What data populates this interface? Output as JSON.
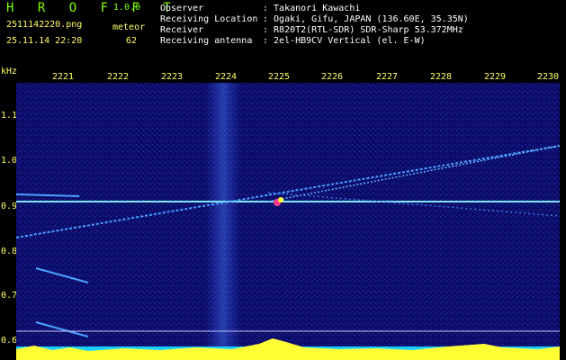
{
  "app": {
    "title": "H R O F F T",
    "version": "1.0.0"
  },
  "file": {
    "name": "2511142220.png",
    "datetime": "25.11.14 22:20"
  },
  "meteor": {
    "label": "meteor",
    "count": "62"
  },
  "station": {
    "observer": {
      "label": "Observer",
      "value": ": Takanori Kawachi"
    },
    "location": {
      "label": "Receiving Location",
      "value": ": Ogaki, Gifu, JAPAN (136.60E, 35.35N)"
    },
    "receiver": {
      "label": "Receiver",
      "value": ": R820T2(RTL-SDR) SDR-Sharp 53.372MHz"
    },
    "antenna": {
      "label": "Receiving antenna",
      "value": ": 2el-HB9CV Vertical (el. E-W)"
    }
  },
  "axes": {
    "y_unit": "kHz",
    "x_ticks": [
      "2221",
      "2222",
      "2223",
      "2224",
      "2225",
      "2226",
      "2227",
      "2228",
      "2229",
      "2230"
    ],
    "y_ticks": [
      "1.1",
      "1.0",
      "0.9",
      "0.8",
      "0.7",
      "0.6"
    ]
  },
  "colors": {
    "background": "#0a0a62",
    "carrier": "#7fe8ff",
    "trail": "#4aa0ff",
    "baseline_fill": "#ffff33"
  }
}
